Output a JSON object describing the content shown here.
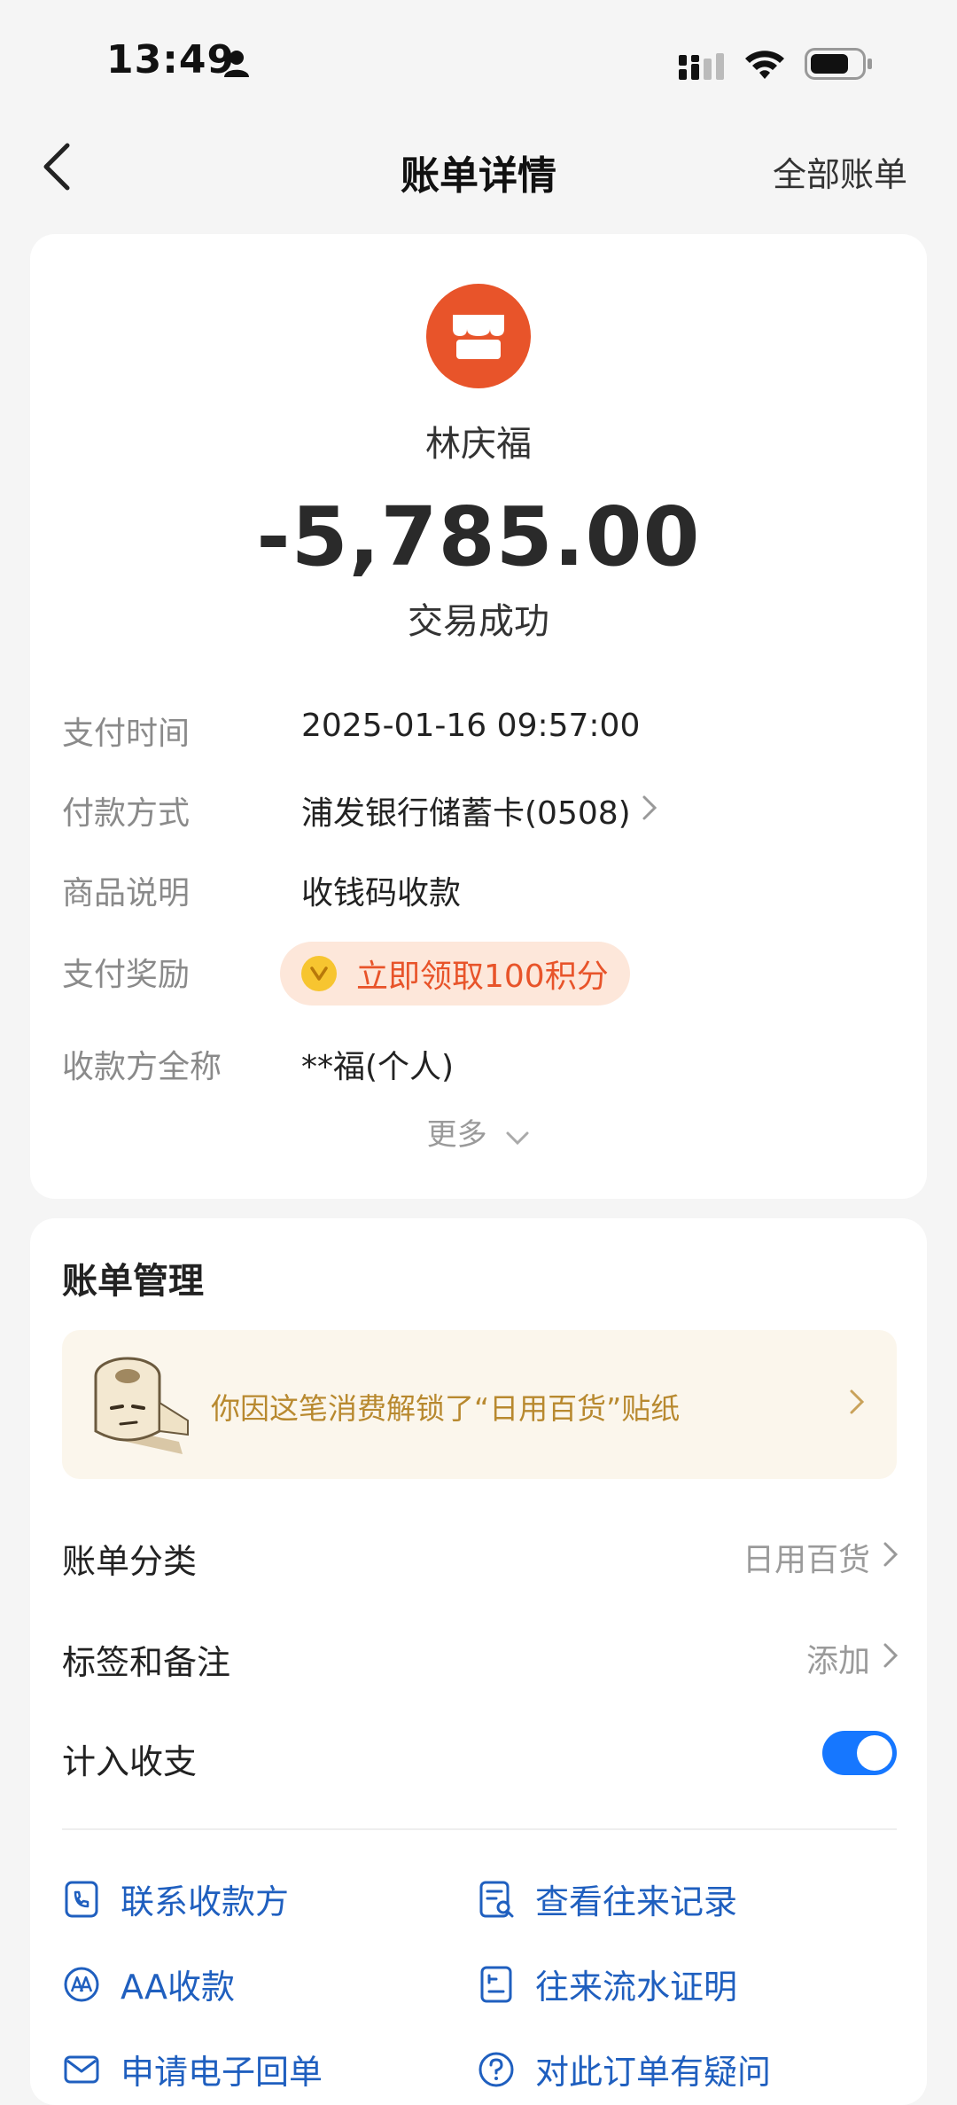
{
  "status_bar": {
    "time": "13:49"
  },
  "nav": {
    "title": "账单详情",
    "right_link": "全部账单"
  },
  "transaction": {
    "merchant": "林庆福",
    "amount": "-5,785.00",
    "status": "交易成功"
  },
  "details": [
    {
      "label": "支付时间",
      "value": "2025-01-16 09:57:00"
    },
    {
      "label": "付款方式",
      "value": "浦发银行储蓄卡(0508)"
    },
    {
      "label": "商品说明",
      "value": "收钱码收款"
    },
    {
      "label": "支付奖励",
      "value": "立即领取100积分"
    },
    {
      "label": "收款方全称",
      "value": "**福(个人)"
    }
  ],
  "more_label": "更多",
  "management": {
    "title": "账单管理",
    "sticker_text": "你因这笔消费解锁了“日用百货”贴纸",
    "category_label": "账单分类",
    "category_value": "日用百货",
    "tags_label": "标签和备注",
    "tags_value": "添加",
    "include_label": "计入收支",
    "include_enabled": true
  },
  "actions": [
    {
      "label": "联系收款方",
      "icon": "phone-icon"
    },
    {
      "label": "查看往来记录",
      "icon": "record-search-icon"
    },
    {
      "label": "AA收款",
      "icon": "aa-icon"
    },
    {
      "label": "往来流水证明",
      "icon": "statement-icon"
    },
    {
      "label": "申请电子回单",
      "icon": "mail-icon"
    },
    {
      "label": "对此订单有疑问",
      "icon": "question-icon"
    }
  ],
  "colors": {
    "accent_blue": "#1677ff",
    "action_blue": "#1f5fbf",
    "merchant_orange": "#e8542a",
    "reward_bg": "#fde7da",
    "sticker_text": "#b8892f"
  }
}
